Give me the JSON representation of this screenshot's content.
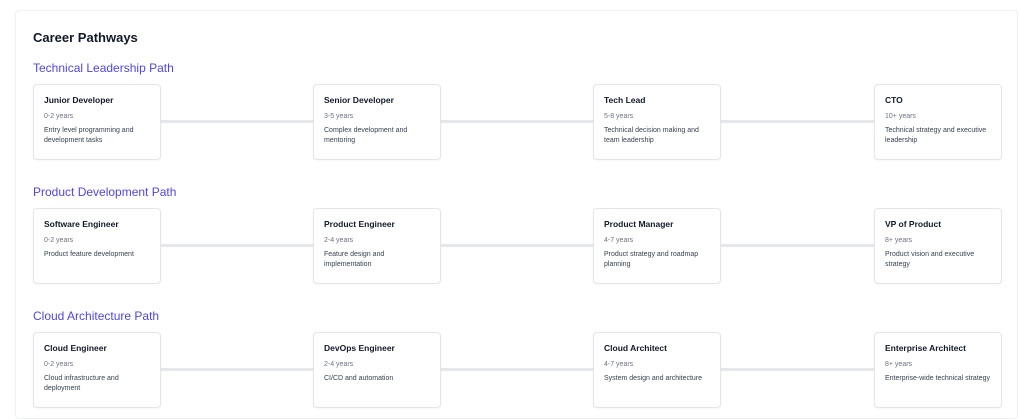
{
  "page": {
    "title": "Career Pathways"
  },
  "paths": [
    {
      "title": "Technical Leadership Path",
      "stages": [
        {
          "title": "Junior Developer",
          "years": "0-2 years",
          "description": "Entry level programming and development tasks"
        },
        {
          "title": "Senior Developer",
          "years": "3-5 years",
          "description": "Complex development and mentoring"
        },
        {
          "title": "Tech Lead",
          "years": "5-8 years",
          "description": "Technical decision making and team leadership"
        },
        {
          "title": "CTO",
          "years": "10+ years",
          "description": "Technical strategy and executive leadership"
        }
      ]
    },
    {
      "title": "Product Development Path",
      "stages": [
        {
          "title": "Software Engineer",
          "years": "0-2 years",
          "description": "Product feature development"
        },
        {
          "title": "Product Engineer",
          "years": "2-4 years",
          "description": "Feature design and implementation"
        },
        {
          "title": "Product Manager",
          "years": "4-7 years",
          "description": "Product strategy and roadmap planning"
        },
        {
          "title": "VP of Product",
          "years": "8+ years",
          "description": "Product vision and executive strategy"
        }
      ]
    },
    {
      "title": "Cloud Architecture Path",
      "stages": [
        {
          "title": "Cloud Engineer",
          "years": "0-2 years",
          "description": "Cloud infrastructure and deployment"
        },
        {
          "title": "DevOps Engineer",
          "years": "2-4 years",
          "description": "CI/CD and automation"
        },
        {
          "title": "Cloud Architect",
          "years": "4-7 years",
          "description": "System design and architecture"
        },
        {
          "title": "Enterprise Architect",
          "years": "8+ years",
          "description": "Enterprise-wide technical strategy"
        }
      ]
    }
  ]
}
